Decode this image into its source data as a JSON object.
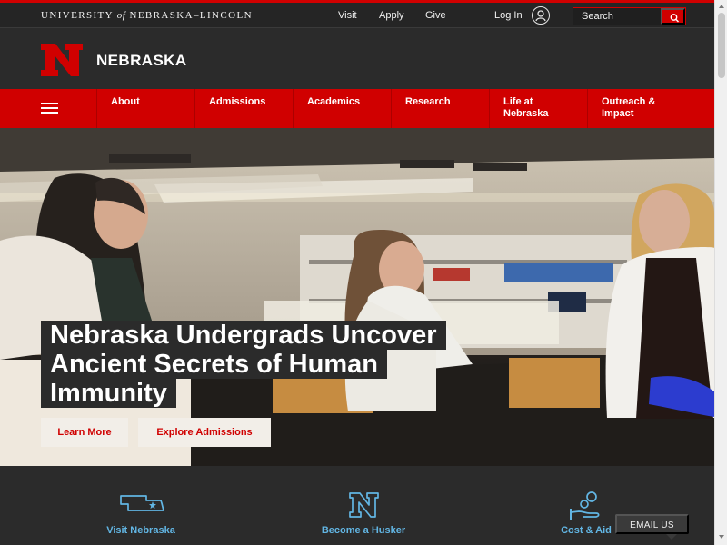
{
  "utility_bar": {
    "wordmark": {
      "part1": "UNIVERSITY",
      "part2": "of",
      "part3": "NEBRASKA–LINCOLN"
    },
    "links": [
      "Visit",
      "Apply",
      "Give"
    ],
    "login": "Log In",
    "search_placeholder": "Search"
  },
  "brand": {
    "logo_letter": "N",
    "title": "NEBRASKA"
  },
  "main_nav": {
    "items": [
      {
        "line1": "About",
        "line2": ""
      },
      {
        "line1": "Admissions",
        "line2": ""
      },
      {
        "line1": "Academics",
        "line2": ""
      },
      {
        "line1": "Research",
        "line2": ""
      },
      {
        "line1": "Life at",
        "line2": "Nebraska"
      },
      {
        "line1": "Outreach &",
        "line2": "Impact"
      }
    ]
  },
  "hero": {
    "headline_lines": [
      "Nebraska Undergrads Uncover",
      "Ancient Secrets of Human",
      "Immunity"
    ],
    "buttons": {
      "learn_more": "Learn More",
      "explore_admissions": "Explore Admissions"
    }
  },
  "quick_links": [
    {
      "label": "Visit Nebraska",
      "icon": "nebraska-map-icon"
    },
    {
      "label": "Become a Husker",
      "icon": "n-logo-icon"
    },
    {
      "label": "Cost & Aid",
      "icon": "hand-coins-icon"
    }
  ],
  "email_widget": {
    "label": "EMAIL US"
  },
  "colors": {
    "brand_red": "#d00000",
    "dark_bg": "#2b2b2b",
    "link_blue": "#62b6e4"
  }
}
